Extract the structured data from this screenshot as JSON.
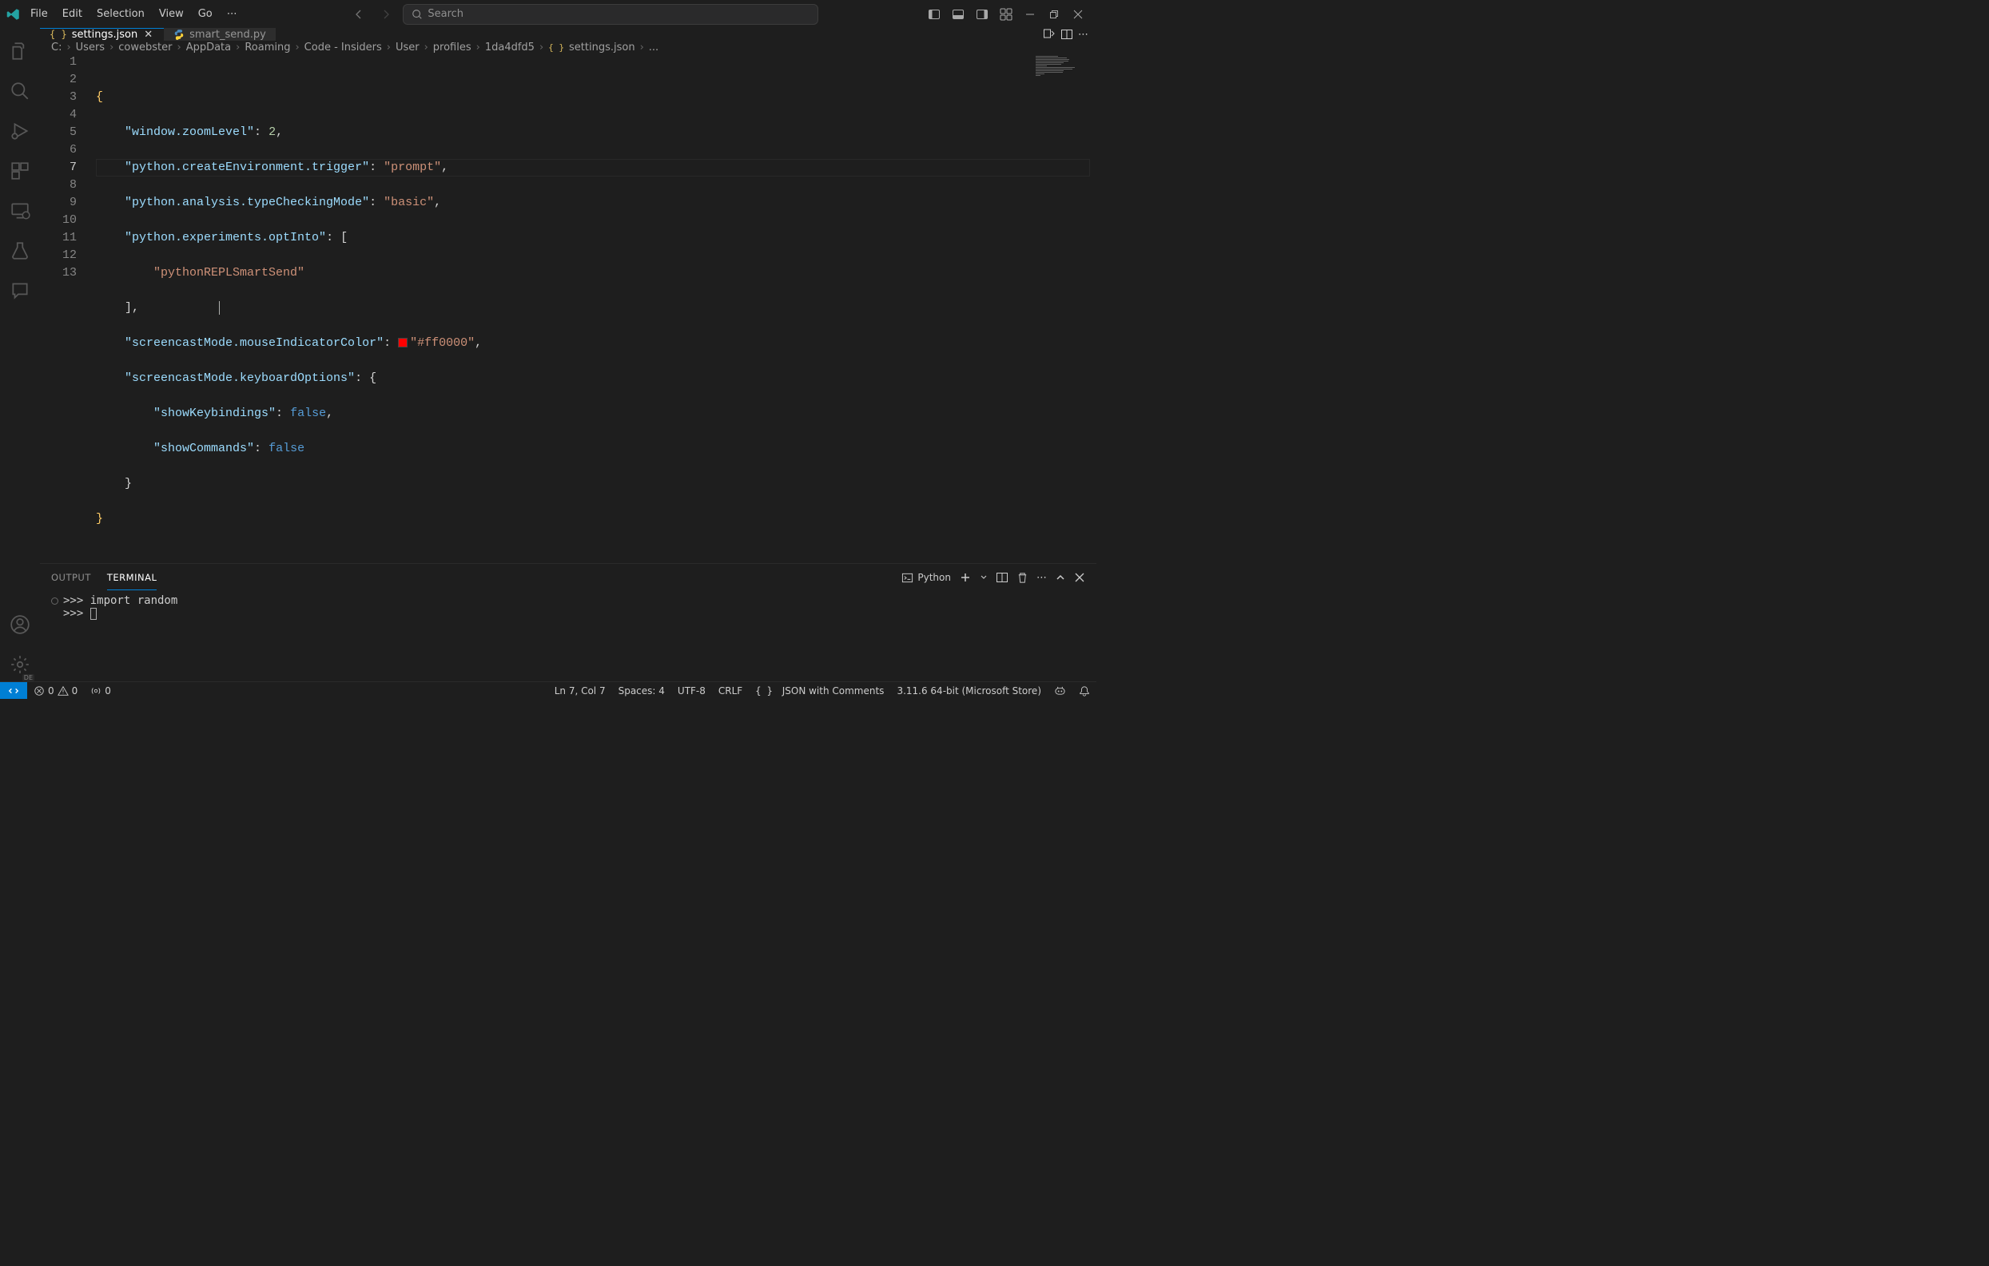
{
  "menu": {
    "file": "File",
    "edit": "Edit",
    "selection": "Selection",
    "view": "View",
    "go": "Go"
  },
  "search": {
    "placeholder": "Search"
  },
  "tabs": [
    {
      "label": "settings.json",
      "icon": "json",
      "active": true,
      "dirty": false
    },
    {
      "label": "smart_send.py",
      "icon": "python",
      "active": false,
      "dirty": false
    }
  ],
  "breadcrumbs": [
    "C:",
    "Users",
    "cowebster",
    "AppData",
    "Roaming",
    "Code - Insiders",
    "User",
    "profiles",
    "1da4dfd5",
    "settings.json",
    "..."
  ],
  "editor": {
    "lineNumbers": [
      "1",
      "2",
      "3",
      "4",
      "5",
      "6",
      "7",
      "8",
      "9",
      "10",
      "11",
      "12",
      "13"
    ],
    "cursorLineIndex": 6,
    "json": {
      "window.zoomLevel": 2,
      "python.createEnvironment.trigger": "prompt",
      "python.analysis.typeCheckingMode": "basic",
      "python.experiments.optInto": [
        "pythonREPLSmartSend"
      ],
      "screencastMode.mouseIndicatorColor": "#ff0000",
      "screencastMode.keyboardOptions": {
        "showKeybindings": false,
        "showCommands": false
      }
    },
    "tokens": {
      "k_zoom": "\"window.zoomLevel\"",
      "v_zoom": "2",
      "k_env": "\"python.createEnvironment.trigger\"",
      "v_env": "\"prompt\"",
      "k_type": "\"python.analysis.typeCheckingMode\"",
      "v_type": "\"basic\"",
      "k_opt": "\"python.experiments.optInto\"",
      "v_optitem": "\"pythonREPLSmartSend\"",
      "k_mouse": "\"screencastMode.mouseIndicatorColor\"",
      "v_mouse": "\"#ff0000\"",
      "k_kbd": "\"screencastMode.keyboardOptions\"",
      "k_showkb": "\"showKeybindings\"",
      "v_false1": "false",
      "k_showcmd": "\"showCommands\"",
      "v_false2": "false"
    }
  },
  "panel": {
    "tabs": {
      "output": "OUTPUT",
      "terminal": "TERMINAL"
    },
    "kernel": "Python",
    "content": {
      "line1": ">>> import random",
      "prompt2": ">>> "
    }
  },
  "status": {
    "errors": "0",
    "warnings": "0",
    "ports": "0",
    "lncol": "Ln 7, Col 7",
    "spaces": "Spaces: 4",
    "encoding": "UTF-8",
    "eol": "CRLF",
    "lang": "JSON with Comments",
    "python": "3.11.6 64-bit (Microsoft Store)"
  },
  "kbdLocale": "DE"
}
